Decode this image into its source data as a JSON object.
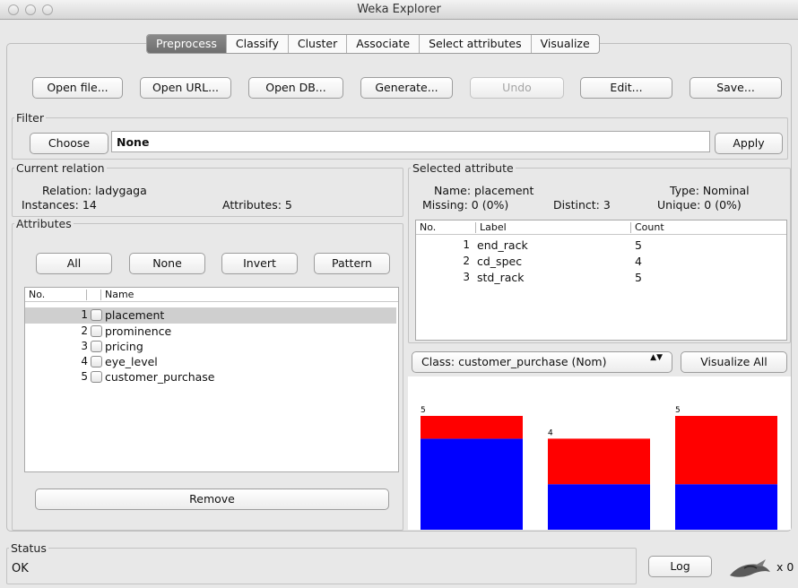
{
  "window": {
    "title": "Weka Explorer"
  },
  "tabs": [
    "Preprocess",
    "Classify",
    "Cluster",
    "Associate",
    "Select attributes",
    "Visualize"
  ],
  "toolbar": {
    "open_file": "Open file...",
    "open_url": "Open URL...",
    "open_db": "Open DB...",
    "generate": "Generate...",
    "undo": "Undo",
    "edit": "Edit...",
    "save": "Save..."
  },
  "filter": {
    "legend": "Filter",
    "choose": "Choose",
    "value": "None",
    "apply": "Apply"
  },
  "current_relation": {
    "legend": "Current relation",
    "relation": "Relation: ladygaga",
    "instances": "Instances: 14",
    "attributes": "Attributes: 5"
  },
  "attributes": {
    "legend": "Attributes",
    "buttons": {
      "all": "All",
      "none": "None",
      "invert": "Invert",
      "pattern": "Pattern"
    },
    "columns": {
      "no": "No.",
      "name": "Name"
    },
    "rows": [
      {
        "no": "1",
        "name": "placement"
      },
      {
        "no": "2",
        "name": "prominence"
      },
      {
        "no": "3",
        "name": "pricing"
      },
      {
        "no": "4",
        "name": "eye_level"
      },
      {
        "no": "5",
        "name": "customer_purchase"
      }
    ],
    "remove": "Remove"
  },
  "selected_attribute": {
    "legend": "Selected attribute",
    "name": "Name: placement",
    "type": "Type: Nominal",
    "missing": "Missing: 0 (0%)",
    "distinct": "Distinct: 3",
    "unique": "Unique: 0 (0%)",
    "columns": {
      "no": "No.",
      "label": "Label",
      "count": "Count"
    },
    "rows": [
      {
        "no": "1",
        "label": "end_rack",
        "count": "5"
      },
      {
        "no": "2",
        "label": "cd_spec",
        "count": "4"
      },
      {
        "no": "3",
        "label": "std_rack",
        "count": "5"
      }
    ]
  },
  "class_select": {
    "value": "Class: customer_purchase (Nom)",
    "arrows": "▲▼"
  },
  "visualize_all": "Visualize All",
  "chart_data": {
    "type": "bar",
    "categories": [
      "end_rack",
      "cd_spec",
      "std_rack"
    ],
    "totals": [
      5,
      4,
      5
    ],
    "series": [
      {
        "values": [
          4,
          2,
          2
        ],
        "color": "#0000ff"
      },
      {
        "values": [
          1,
          2,
          3
        ],
        "color": "#ff0000"
      }
    ],
    "bar_labels": [
      "5",
      "4",
      "5"
    ]
  },
  "status": {
    "legend": "Status",
    "text": "OK",
    "log": "Log",
    "count": "x 0"
  }
}
